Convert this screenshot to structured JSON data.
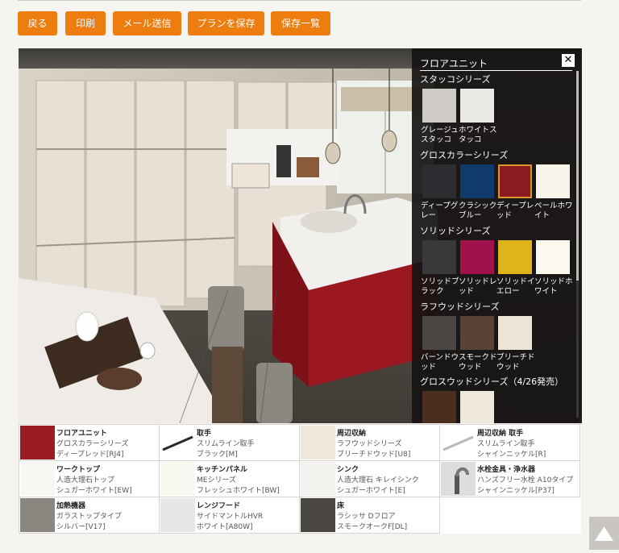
{
  "toolbar": {
    "back": "戻る",
    "print": "印刷",
    "mail": "メール送信",
    "save_plan": "プランを保存",
    "saved_list": "保存一覧"
  },
  "panel": {
    "title": "フロアユニット",
    "close_icon": "close-icon",
    "series": [
      {
        "title": "スタッコシリーズ",
        "items": [
          {
            "label": "グレージュスタッコ",
            "color": "#cfcbc6",
            "selected": false
          },
          {
            "label": "ホワイトスタッコ",
            "color": "#ebe9e5",
            "selected": false
          }
        ]
      },
      {
        "title": "グロスカラーシリーズ",
        "items": [
          {
            "label": "ディープグレー",
            "color": "#2b2d30",
            "selected": false
          },
          {
            "label": "クラシックブルー",
            "color": "#103a6b",
            "selected": false
          },
          {
            "label": "ディープレッド",
            "color": "#8c1a23",
            "selected": true
          },
          {
            "label": "ペールホワイト",
            "color": "#f8f4ea",
            "selected": false
          }
        ]
      },
      {
        "title": "ソリッドシリーズ",
        "items": [
          {
            "label": "ソリッドブラック",
            "color": "#38383a",
            "selected": false
          },
          {
            "label": "ソリッドレッド",
            "color": "#a0124b",
            "selected": false
          },
          {
            "label": "ソリッドイエロー",
            "color": "#e0b21c",
            "selected": false
          },
          {
            "label": "ソリッドホワイト",
            "color": "#fbf8ee",
            "selected": false
          }
        ]
      },
      {
        "title": "ラフウッドシリーズ",
        "items": [
          {
            "label": "バーンドウッド",
            "color": "#4a4743",
            "selected": false
          },
          {
            "label": "スモークドウッド",
            "color": "#5a4334",
            "selected": false
          },
          {
            "label": "ブリーチドウッド",
            "color": "#ece4d4",
            "selected": false
          }
        ]
      },
      {
        "title": "グロスウッドシリーズ（4/26発売）",
        "items": [
          {
            "label": "",
            "color": "#4a2e1e",
            "selected": false
          },
          {
            "label": "",
            "color": "#eee8dc",
            "selected": false
          }
        ]
      }
    ]
  },
  "summary": [
    {
      "title": "フロアユニット",
      "line1": "グロスカラーシリーズ",
      "line2": "ディープレッド[RJ4]",
      "thumb": "#9b1c22"
    },
    {
      "title": "取手",
      "line1": "スリムライン取手",
      "line2": "ブラック[M]",
      "thumb": "handle-black"
    },
    {
      "title": "周辺収納",
      "line1": "ラフウッドシリーズ",
      "line2": "ブリーチドウッド[U8]",
      "thumb": "#efe7d8"
    },
    {
      "title": "周辺収納 取手",
      "line1": "スリムライン取手",
      "line2": "シャインニッケル[R]",
      "thumb": "handle-nickel"
    },
    {
      "title": "ワークトップ",
      "line1": "人造大理石トップ",
      "line2": "シュガーホワイト[EW]",
      "thumb": "#f7f7f4"
    },
    {
      "title": "キッチンパネル",
      "line1": "MEシリーズ",
      "line2": "フレッシュホワイト[BW]",
      "thumb": "#f8f7f0"
    },
    {
      "title": "シンク",
      "line1": "人造大理石 キレイシンク",
      "line2": "シュガーホワイト[E]",
      "thumb": "#f3f2ef"
    },
    {
      "title": "水栓金具・浄水器",
      "line1": "ハンズフリー水栓 A10タイプ",
      "line2": "シャインニッケル[P37]",
      "thumb": "faucet"
    },
    {
      "title": "加熱機器",
      "line1": "ガラストップタイプ",
      "line2": "シルバー[V17]",
      "thumb": "#8a8680"
    },
    {
      "title": "レンジフード",
      "line1": "サイドマントルHVR",
      "line2": "ホワイト[A80W]",
      "thumb": "#e6e7e8"
    },
    {
      "title": "床",
      "line1": "ラシッサ Dフロア",
      "line2": "スモークオークF[DL]",
      "thumb": "#4b4743"
    }
  ]
}
